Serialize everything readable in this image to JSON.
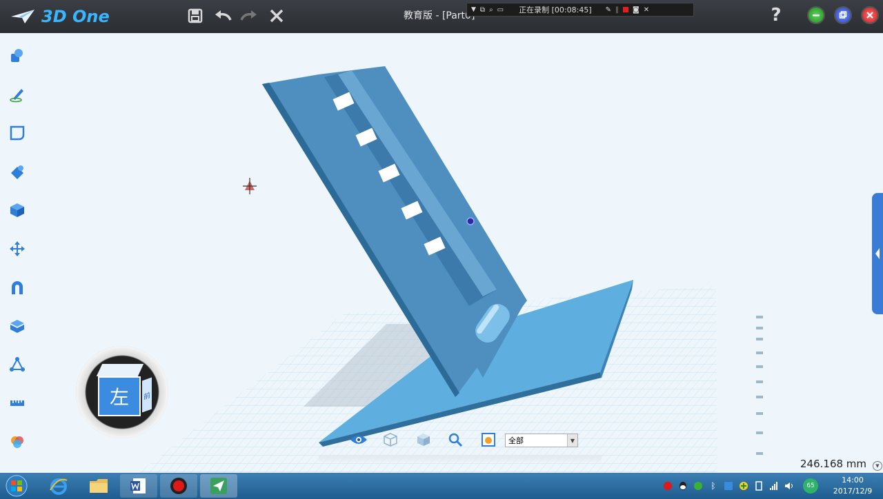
{
  "app": {
    "logo_text": "3D One",
    "document_title": "教育版 - [Part0",
    "document_title_suffix": "]"
  },
  "recording": {
    "status_text": "正在录制 [00:08:45]"
  },
  "help": {
    "label": "?"
  },
  "viewport": {
    "nav_cube_face": "左",
    "nav_cube_side": "前",
    "distance_readout": "246.168 mm"
  },
  "bottom_toolbar": {
    "filter_selected": "全部"
  },
  "tray": {
    "badge": "65"
  },
  "clock": {
    "time": "14:00",
    "date": "2017/12/9"
  },
  "colors": {
    "accent": "#38b6ff",
    "model": "#4f8fbf",
    "grid": "#a9d4ec",
    "taskbar": "#2a6aa0"
  }
}
